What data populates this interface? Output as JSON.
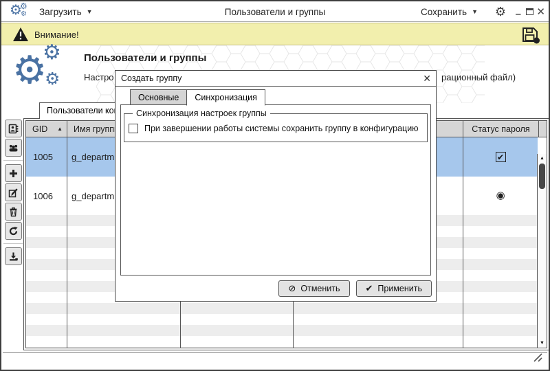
{
  "titlebar": {
    "load_label": "Загрузить",
    "window_title": "Пользователи и группы",
    "save_label": "Сохранить"
  },
  "warning_bar": {
    "message": "Внимание!"
  },
  "page": {
    "heading": "Пользователи и группы",
    "subtitle_left_fragment": "Настро",
    "subtitle_right_fragment": "рационный файл)",
    "users_tab_label": "Пользователи кон"
  },
  "toolbar": {
    "buttons": [
      "contacts-book",
      "user-groups",
      "add",
      "edit",
      "delete",
      "refresh",
      "export"
    ]
  },
  "table": {
    "headers": {
      "gid": "GID",
      "group_name": "Имя группы",
      "password_status": "Статус пароля"
    },
    "rows": [
      {
        "gid": "1005",
        "group_name": "g_departm",
        "selected": true,
        "password_status": "checkbox-checked"
      },
      {
        "gid": "1006",
        "group_name": "g_departm",
        "selected": false,
        "password_status": "radio-selected"
      }
    ]
  },
  "dialog": {
    "title": "Создать группу",
    "tabs": [
      {
        "label": "Основные",
        "active": false
      },
      {
        "label": "Синхронизация",
        "active": true
      }
    ],
    "sync_group_legend": "Синхронизация настроек группы",
    "checkbox_label": "При завершении работы системы сохранить группу в конфигурацию",
    "checkbox_checked": false,
    "cancel_label": "Отменить",
    "apply_label": "Применить"
  },
  "icons": {
    "gear": "⚙",
    "dropdown": "▼",
    "sort_asc": "▲",
    "minimize": "–",
    "close": "✕",
    "check": "✔",
    "cancel": "⊘",
    "radio_on": "◉",
    "scroll_up": "▲",
    "scroll_down": "▼"
  },
  "colors": {
    "accent_blue": "#4a72a3",
    "selected_row": "#a6c7ec",
    "warning_bg": "#f2efad",
    "header_bg": "#d6d6d6",
    "stripe": "#ededed",
    "border": "#555555",
    "button_bg": "#e3e3e3"
  }
}
